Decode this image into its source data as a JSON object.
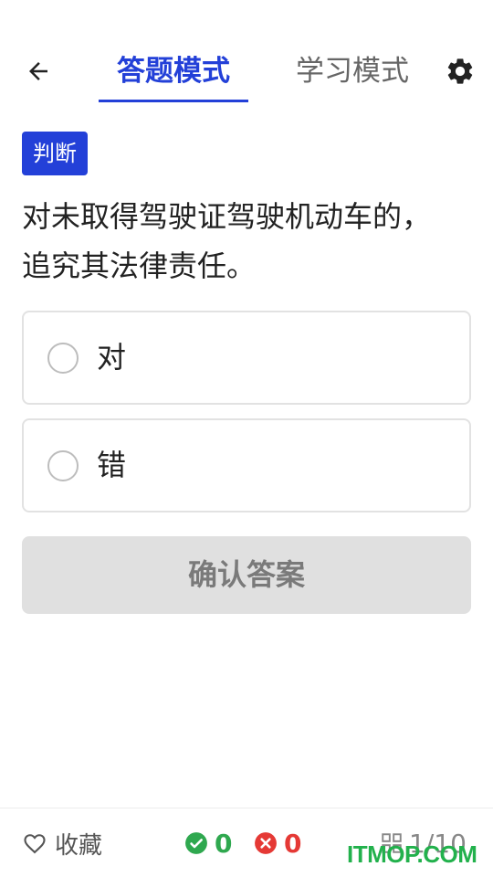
{
  "header": {
    "back_icon": "arrow-left-icon",
    "tabs": [
      {
        "label": "答题模式",
        "active": true
      },
      {
        "label": "学习模式",
        "active": false
      }
    ],
    "settings_icon": "gear-icon"
  },
  "question": {
    "type_label": "判断",
    "text": "对未取得驾驶证驾驶机动车的，追究其法律责任。",
    "options": [
      {
        "label": "对"
      },
      {
        "label": "错"
      }
    ]
  },
  "confirm_label": "确认答案",
  "footer": {
    "favorite_label": "收藏",
    "correct_count": "0",
    "wrong_count": "0",
    "progress": "1/10"
  },
  "watermark": "ITMOP.COM",
  "colors": {
    "accent": "#2340d8",
    "correct": "#2fa84f",
    "wrong": "#e53935",
    "disabled_button": "#e0e0e0",
    "watermark": "#22b14c"
  }
}
